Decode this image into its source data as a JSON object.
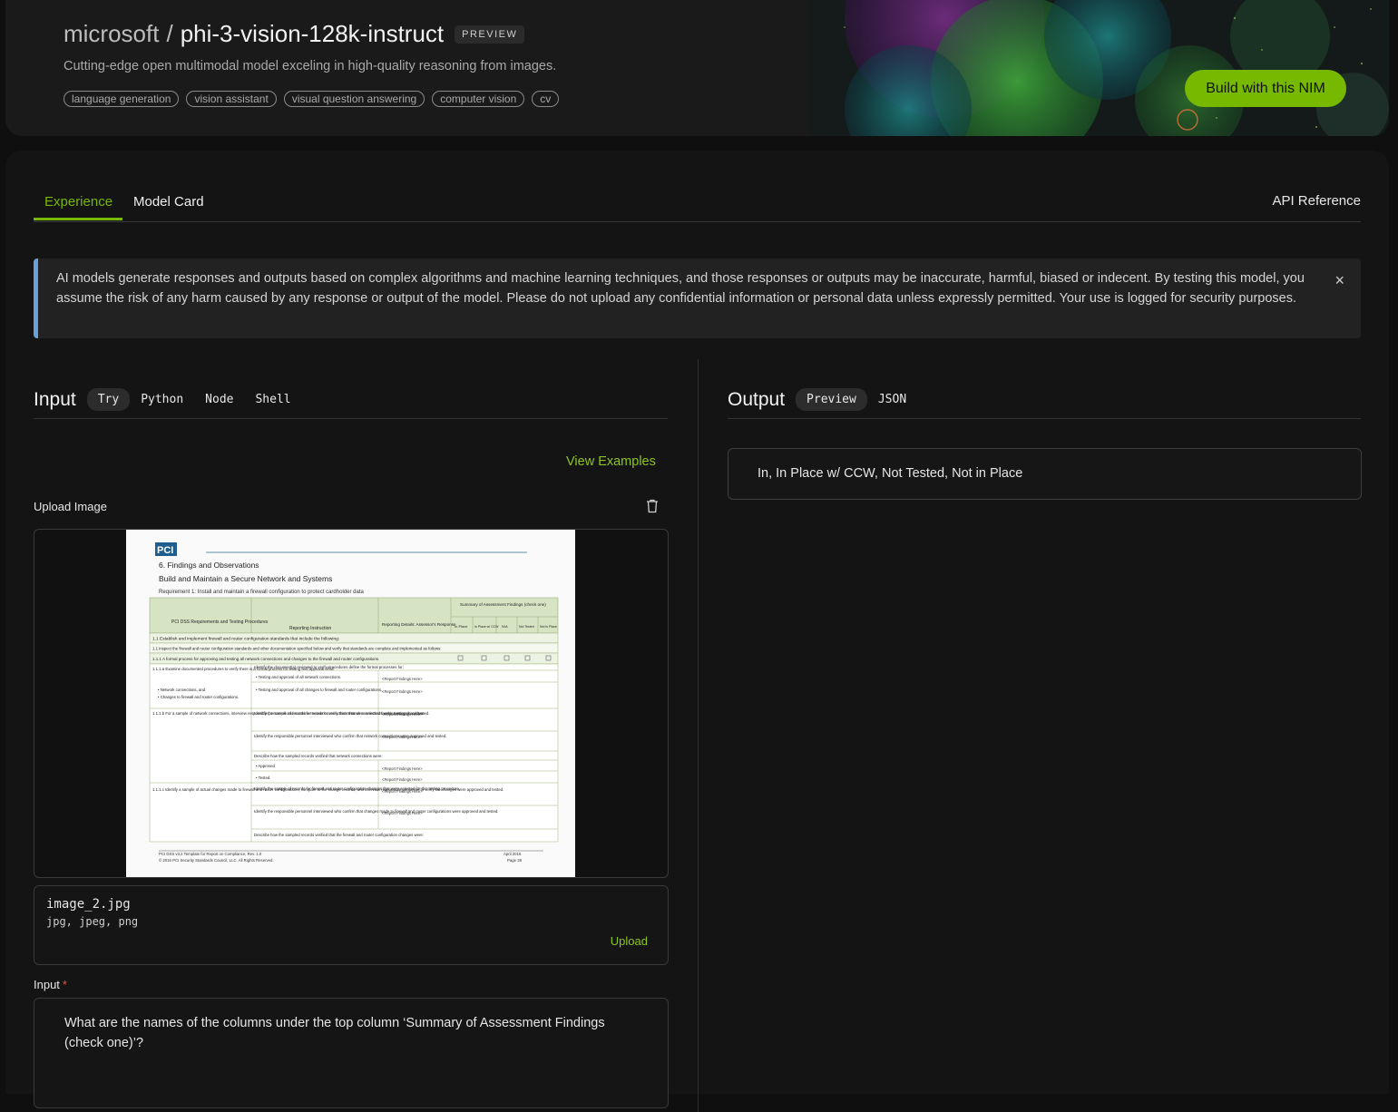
{
  "header": {
    "org": "microsoft",
    "separator": "/",
    "model": "phi-3-vision-128k-instruct",
    "badge": "PREVIEW",
    "subtitle": "Cutting-edge open multimodal model exceling in high-quality reasoning from images.",
    "tags": [
      "language generation",
      "vision assistant",
      "visual question answering",
      "computer vision",
      "cv"
    ],
    "build_button": "Build with this NIM"
  },
  "tabs": {
    "items": [
      "Experience",
      "Model Card"
    ],
    "active": "Experience",
    "api_reference": "API Reference"
  },
  "notice": {
    "text": "AI models generate responses and outputs based on complex algorithms and machine learning techniques, and those responses or outputs may be inaccurate, harmful, biased or indecent. By testing this model, you assume the risk of any harm caused by any response or output of the model. Please do not upload any confidential information or personal data unless expressly permitted. Your use is logged for security purposes.",
    "close": "×"
  },
  "input": {
    "title": "Input",
    "modes": [
      "Try",
      "Python",
      "Node",
      "Shell"
    ],
    "active_mode": "Try",
    "view_examples": "View Examples",
    "upload_label": "Upload Image",
    "file_name": "image_2.jpg",
    "file_types": "jpg, jpeg, png",
    "upload_button": "Upload",
    "prompt_label": "Input",
    "required_mark": "*",
    "prompt_text": "What are the names of the columns under the top column ‘Summary of Assessment Findings (check one)’?"
  },
  "output": {
    "title": "Output",
    "modes": [
      "Preview",
      "JSON"
    ],
    "active_mode": "Preview",
    "text": "In, In Place w/ CCW, Not Tested, Not in Place"
  },
  "document_preview": {
    "logo": "PCI",
    "section": "6.  Findings and Observations",
    "heading": "Build and Maintain a Secure Network and Systems",
    "requirement": "Requirement 1:  Install and maintain a firewall configuration to protect cardholder data",
    "col_headers": [
      "PCI DSS Requirements and Testing Procedures",
      "Reporting Instruction",
      "Reporting Details: Assessor's Response"
    ],
    "summary_header": "Summary of Assessment Findings (check one)",
    "summary_cols": [
      "In Place",
      "In Place w/ CCW",
      "N/A",
      "Not Tested",
      "Not in Place"
    ],
    "rows": [
      "1.1 Establish and implement firewall and router configuration standards that include the following:",
      "1.1 Inspect the firewall and router configuration standards and other documentation specified below and verify that standards are complete and implemented as follows:",
      "1.1.1 A formal process for approving and testing all network connections and changes to the firewall and router configurations."
    ],
    "left_cells": [
      "1.1.1.a Examine documented procedures to verify there is a formal process for testing and approval of all:",
      "• Network connections, and",
      "• Changes to firewall and router configurations.",
      "1.1.1.b For a sample of network connections, interview responsible personnel and examine records to verify that network connections were approved and tested.",
      "1.1.1.c Identify a sample of actual changes made to firewall and router configurations, compare to the change records, and interview responsible personnel to verify the changes were approved and tested."
    ],
    "mid_cells": [
      "Identify the document(s) reviewed to verify procedures define the formal processes for:",
      "• Testing and approval of all network connections.",
      "• Testing and approval of all changes to firewall and router configurations.",
      "Identify the sample of records for network connections that were selected for this testing procedure.",
      "Identify the responsible personnel interviewed who confirm that network connections were approved and tested.",
      "Describe how the sampled records verified that network connections were:",
      "• Approved",
      "• Tested",
      "Identify the sample of records for firewall and router configuration changes that were selected for this testing procedure.",
      "Identify the responsible personnel interviewed who confirm that changes made to firewall and router configurations were approved and tested.",
      "Describe how the sampled records verified that the firewall and router configuration changes were:"
    ],
    "placeholder": "<Report Findings Here>",
    "footer_left": "PCI DSS v3.2 Template for Report on Compliance, Rev. 1.0",
    "footer_left2": "© 2016 PCI Security Standards Council, LLC. All Rights Reserved.",
    "footer_right": "April 2016",
    "footer_right2": "Page 28"
  },
  "colors": {
    "accent": "#76b900",
    "notice_bar": "#6a9fd8",
    "doc_header_green": "#d6e4c4"
  }
}
